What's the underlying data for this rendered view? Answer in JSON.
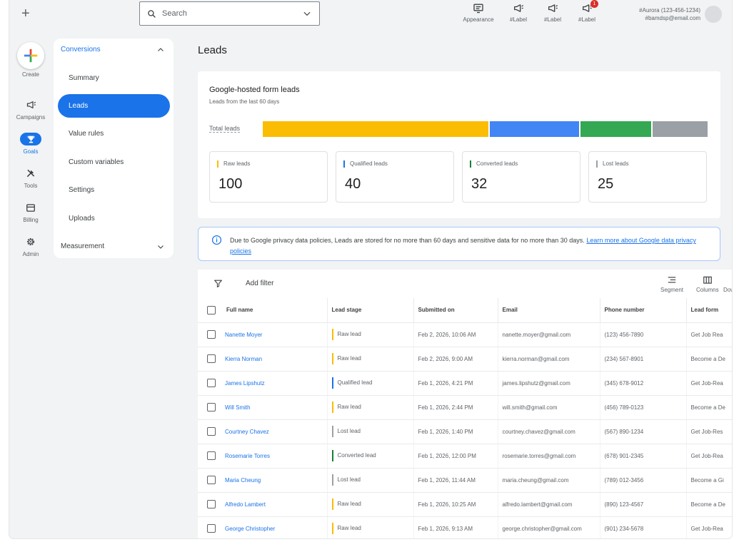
{
  "topbar": {
    "search_placeholder": "Search",
    "icons": [
      {
        "label": "Appearance",
        "icon": "appearance-icon"
      },
      {
        "label": "#Label",
        "icon": "megaphone-icon"
      },
      {
        "label": "#Label",
        "icon": "megaphone-icon"
      },
      {
        "label": "#Label",
        "icon": "megaphone-icon",
        "badge": "1"
      }
    ],
    "account_name": "#Aurora (123-456-1234)",
    "account_email": "#bamdsp@email.com"
  },
  "rail": {
    "create": "Create",
    "items": [
      {
        "label": "Campaigns",
        "icon": "megaphone-icon"
      },
      {
        "label": "Goals",
        "icon": "trophy-icon",
        "active": true
      },
      {
        "label": "Tools",
        "icon": "tools-icon"
      },
      {
        "label": "Billing",
        "icon": "billing-icon"
      },
      {
        "label": "Admin",
        "icon": "gear-icon"
      }
    ]
  },
  "subnav": {
    "section": "Conversions",
    "items": [
      "Summary",
      "Leads",
      "Value rules",
      "Custom variables",
      "Settings",
      "Uploads"
    ],
    "active": "Leads",
    "section2": "Measurement"
  },
  "page": {
    "title": "Leads"
  },
  "summary": {
    "title": "Google-hosted form leads",
    "subtitle": "Leads from the last 60 days",
    "bar_label": "Total leads",
    "segments": [
      {
        "name": "Raw leads",
        "value": 100,
        "color": "#fbbc04"
      },
      {
        "name": "Qualified leads",
        "value": 40,
        "color": "#4285f4"
      },
      {
        "name": "Converted leads",
        "value": 32,
        "color": "#34a853"
      },
      {
        "name": "Lost leads",
        "value": 25,
        "color": "#9aa0a6"
      }
    ],
    "stats": [
      {
        "label": "Raw leads",
        "value": "100",
        "color": "#fbbc04"
      },
      {
        "label": "Qualified leads",
        "value": "40",
        "color": "#1a73e8"
      },
      {
        "label": "Converted leads",
        "value": "32",
        "color": "#188038"
      },
      {
        "label": "Lost leads",
        "value": "25",
        "color": "#9aa0a6"
      }
    ]
  },
  "notice": {
    "text": "Due to Google privacy data policies, Leads are stored for no more than 60 days and sensitive data for no more than 30 days.",
    "link": "Learn more about Google data privacy policies"
  },
  "table": {
    "add_filter": "Add filter",
    "tools": [
      "Segment",
      "Columns",
      "Dow"
    ],
    "columns": [
      "Full name",
      "Lead stage",
      "Submitted on",
      "Email",
      "Phone number",
      "Lead form"
    ],
    "rows": [
      {
        "name": "Nanette Moyer",
        "stage": "Raw lead",
        "stage_color": "#fbbc04",
        "submitted": "Feb 2, 2026, 10:06 AM",
        "email": "nanette.moyer@gmail.com",
        "phone": "(123) 456-7890",
        "form": "Get Job Rea"
      },
      {
        "name": "Kierra Norman",
        "stage": "Raw lead",
        "stage_color": "#fbbc04",
        "submitted": "Feb 2, 2026, 9:00 AM",
        "email": "kierra.norman@gmail.com",
        "phone": "(234) 567-8901",
        "form": "Become a De"
      },
      {
        "name": "James Lipshutz",
        "stage": "Qualified lead",
        "stage_color": "#1a73e8",
        "submitted": "Feb 1, 2026, 4:21 PM",
        "email": "james.lipshutz@gmail.com",
        "phone": "(345) 678-9012",
        "form": "Get Job-Rea"
      },
      {
        "name": "Will Smith",
        "stage": "Raw lead",
        "stage_color": "#fbbc04",
        "submitted": "Feb 1, 2026, 2:44 PM",
        "email": "will.smith@gmail.com",
        "phone": "(456) 789-0123",
        "form": "Become a De"
      },
      {
        "name": "Courtney Chavez",
        "stage": "Lost lead",
        "stage_color": "#9aa0a6",
        "submitted": "Feb 1, 2026, 1:40 PM",
        "email": "courtney.chavez@gmail.com",
        "phone": "(567) 890-1234",
        "form": "Get Job-Res"
      },
      {
        "name": "Rosemarie Torres",
        "stage": "Converted lead",
        "stage_color": "#188038",
        "submitted": "Feb 1, 2026, 12:00 PM",
        "email": "rosemarie.torres@gmail.com",
        "phone": "(678) 901-2345",
        "form": "Get Job-Rea"
      },
      {
        "name": "Maria Cheung",
        "stage": "Lost lead",
        "stage_color": "#9aa0a6",
        "submitted": "Feb 1, 2026, 11:44 AM",
        "email": "maria.cheung@gmail.com",
        "phone": "(789) 012-3456",
        "form": "Become a Gi"
      },
      {
        "name": "Alfredo Lambert",
        "stage": "Raw lead",
        "stage_color": "#fbbc04",
        "submitted": "Feb 1, 2026, 10:25 AM",
        "email": "alfredo.lambert@gmail.com",
        "phone": "(890) 123-4567",
        "form": "Become a De"
      },
      {
        "name": "George Christopher",
        "stage": "Raw lead",
        "stage_color": "#fbbc04",
        "submitted": "Feb 1, 2026, 9:13 AM",
        "email": "george.christopher@gmail.com",
        "phone": "(901) 234-5678",
        "form": "Get Job-Rea"
      }
    ]
  }
}
